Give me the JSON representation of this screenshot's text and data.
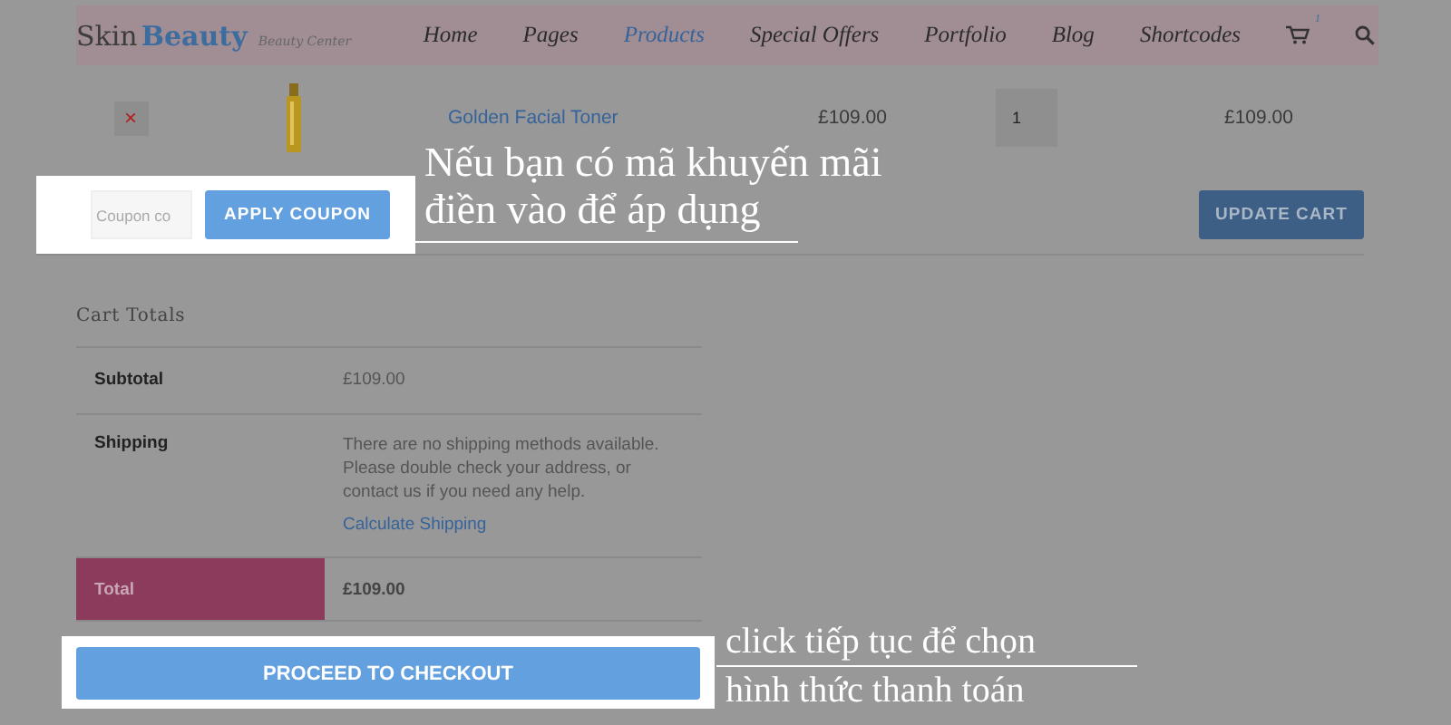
{
  "header": {
    "logo": {
      "first": "Skin",
      "second": "Beauty",
      "tagline": "Beauty Center"
    },
    "nav": [
      {
        "label": "Home",
        "selected": false
      },
      {
        "label": "Pages",
        "selected": false
      },
      {
        "label": "Products",
        "selected": true
      },
      {
        "label": "Special Offers",
        "selected": false
      },
      {
        "label": "Portfolio",
        "selected": false
      },
      {
        "label": "Blog",
        "selected": false
      },
      {
        "label": "Shortcodes",
        "selected": false
      }
    ],
    "cart_count": "1"
  },
  "cart_row": {
    "remove": "×",
    "product": "Golden Facial Toner",
    "price": "£109.00",
    "quantity": "1",
    "total": "£109.00"
  },
  "coupon": {
    "placeholder": "Coupon co",
    "apply": "APPLY COUPON",
    "update": "UPDATE CART"
  },
  "totals": {
    "title": "Cart Totals",
    "rows": [
      {
        "kind": "plain",
        "label": "Subtotal",
        "value": "£109.00"
      },
      {
        "kind": "shipping",
        "label": "Shipping",
        "note": "There are no shipping methods available. Please double check your address, or contact us if you need any help.",
        "link": "Calculate Shipping"
      },
      {
        "kind": "total",
        "label": "Total",
        "value": "£109.00"
      }
    ]
  },
  "checkout": "PROCEED TO CHECKOUT",
  "annotations": [
    {
      "kind": "underline-below",
      "lines": [
        "Nếu bạn có mã khuyến mãi",
        "điền vào để áp dụng"
      ]
    },
    {
      "kind": "underline-between",
      "lines": [
        "click tiếp tục để chọn",
        "hình thức thanh toán"
      ]
    }
  ]
}
